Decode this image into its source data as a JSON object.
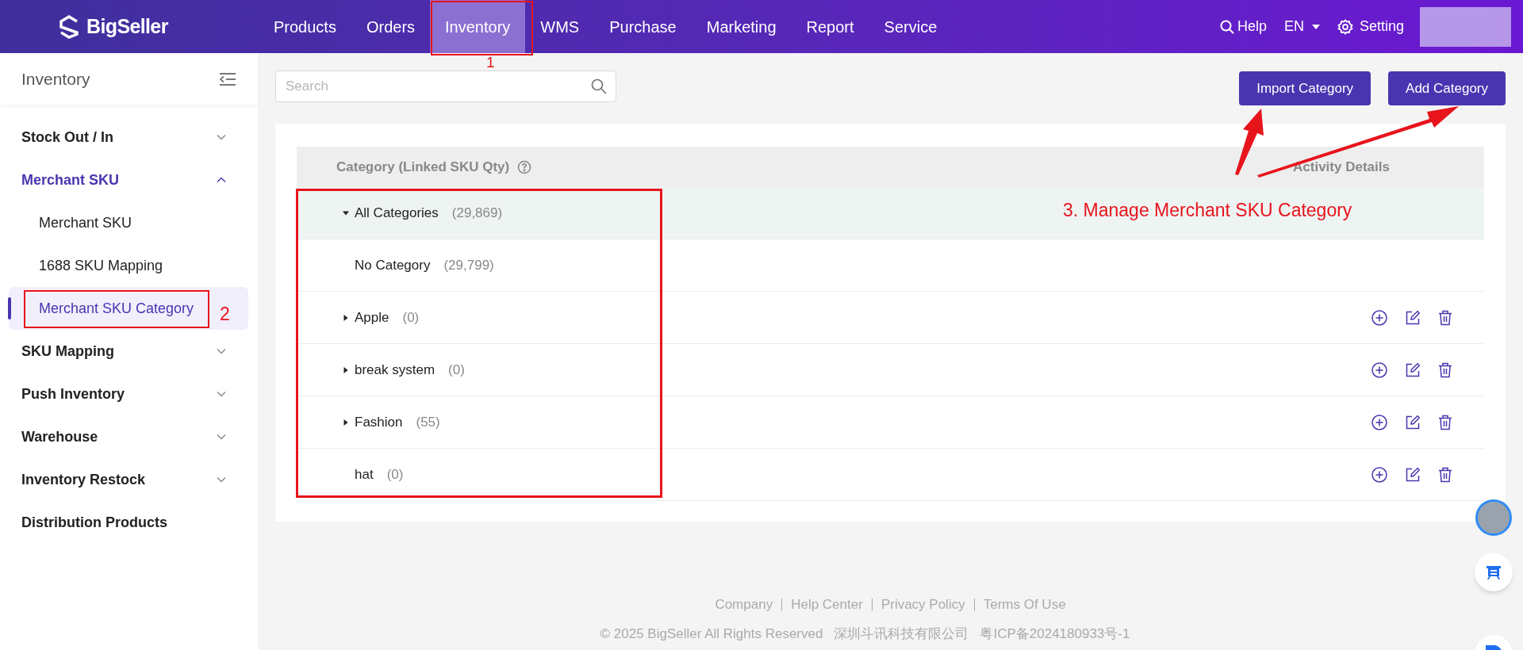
{
  "header": {
    "logo": "BigSeller",
    "nav": [
      {
        "label": "Products",
        "selected": false
      },
      {
        "label": "Orders",
        "selected": false
      },
      {
        "label": "Inventory",
        "selected": true
      },
      {
        "label": "WMS",
        "selected": false
      },
      {
        "label": "Purchase",
        "selected": false
      },
      {
        "label": "Marketing",
        "selected": false
      },
      {
        "label": "Report",
        "selected": false
      },
      {
        "label": "Service",
        "selected": false
      }
    ],
    "help": "Help",
    "language": "EN",
    "setting": "Setting"
  },
  "sidebar": {
    "title": "Inventory",
    "items": [
      {
        "label": "Stock Out / In",
        "expanded": false
      },
      {
        "label": "Merchant SKU",
        "expanded": true,
        "children": [
          {
            "label": "Merchant SKU",
            "selected": false
          },
          {
            "label": "1688 SKU Mapping",
            "selected": false
          },
          {
            "label": "Merchant SKU Category",
            "selected": true
          }
        ]
      },
      {
        "label": "SKU Mapping",
        "expanded": false
      },
      {
        "label": "Push Inventory",
        "expanded": false
      },
      {
        "label": "Warehouse",
        "expanded": false
      },
      {
        "label": "Inventory Restock",
        "expanded": false
      },
      {
        "label": "Distribution Products"
      }
    ]
  },
  "search": {
    "placeholder": "Search"
  },
  "buttons": [
    "Import Category",
    "Add Category"
  ],
  "table": {
    "columns": [
      "Category (Linked SKU Qty)",
      "Activity Details"
    ],
    "tree": [
      {
        "name": "All Categories",
        "count": "(29,869)",
        "expanded": true,
        "highlighted": true,
        "actions": false,
        "children": [
          {
            "name": "No Category",
            "count": "(29,799)",
            "highlighted": false,
            "actions": false
          },
          {
            "name": "Apple",
            "count": "(0)",
            "expanded": false,
            "highlighted": false,
            "actions": true
          },
          {
            "name": "break system",
            "count": "(0)",
            "expanded": false,
            "highlighted": false,
            "actions": true
          },
          {
            "name": "Fashion",
            "count": "(55)",
            "expanded": false,
            "highlighted": false,
            "actions": true
          },
          {
            "name": "hat",
            "count": "(0)",
            "highlighted": false,
            "actions": true
          }
        ]
      }
    ]
  },
  "footer": {
    "links": [
      "Company",
      "Help Center",
      "Privacy Policy",
      "Terms Of Use"
    ],
    "copyright": "© 2025 BigSeller All Rights Reserved",
    "company": "深圳斗讯科技有限公司",
    "icp": "粤ICP备2024180933号-1"
  },
  "annotations": [
    "1",
    "2",
    "3. Manage Merchant SKU Category"
  ]
}
